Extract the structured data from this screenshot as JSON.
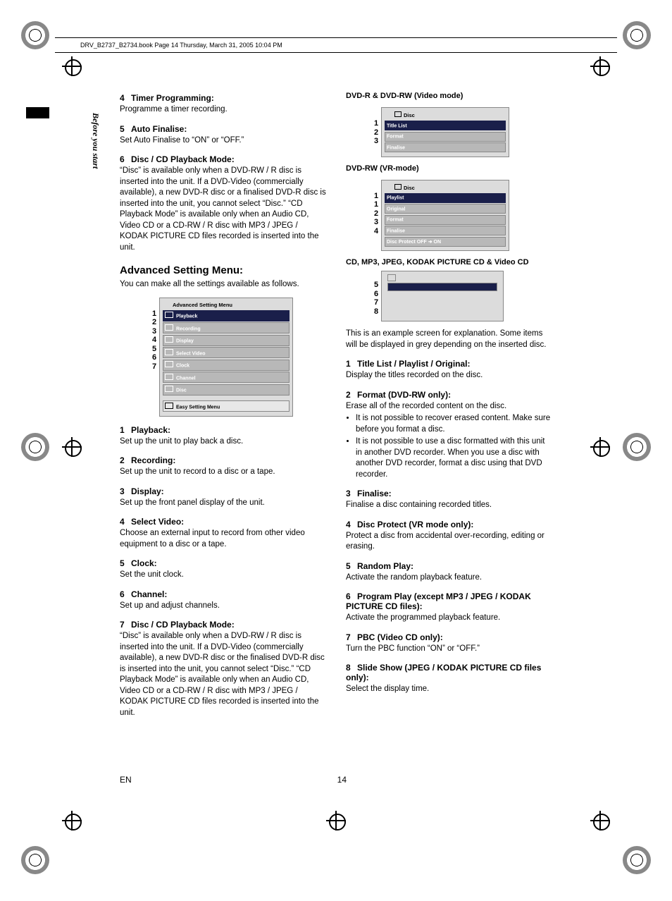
{
  "meta": {
    "header": "DRV_B2737_B2734.book  Page 14  Thursday, March 31, 2005  10:04 PM",
    "sidebar": "Before you start",
    "footer_left": "EN",
    "footer_page": "14"
  },
  "left": {
    "h4": {
      "n": "4",
      "t": "Timer Programming:",
      "b": "Programme a timer recording."
    },
    "h5": {
      "n": "5",
      "t": "Auto Finalise:",
      "b": "Set Auto Finalise to “ON” or “OFF.”"
    },
    "h6": {
      "n": "6",
      "t": "Disc / CD Playback Mode:",
      "b": "“Disc” is available only when a DVD-RW / R disc is inserted into the unit. If a DVD-Video (commercially available), a new DVD-R disc or a finalised DVD-R disc is inserted into the unit, you cannot select “Disc.” “CD Playback Mode” is available only when an Audio CD, Video CD or a CD-RW / R disc with MP3 / JPEG / KODAK PICTURE CD files recorded is inserted into the unit."
    },
    "section": "Advanced Setting Menu:",
    "section_intro": "You can make all the settings available as follows.",
    "menu": {
      "title": "Advanced Setting Menu",
      "rows": [
        "Playback",
        "Recording",
        "Display",
        "Select Video",
        "Clock",
        "Channel",
        "Disc"
      ],
      "last": "Easy Setting Menu",
      "nums": [
        "1",
        "2",
        "3",
        "4",
        "5",
        "6",
        "7"
      ]
    },
    "items": [
      {
        "n": "1",
        "t": "Playback:",
        "b": "Set up the unit to play back a disc."
      },
      {
        "n": "2",
        "t": "Recording:",
        "b": "Set up the unit to record to a disc or a tape."
      },
      {
        "n": "3",
        "t": "Display:",
        "b": "Set up the front panel display of the unit."
      },
      {
        "n": "4",
        "t": "Select Video:",
        "b": "Choose an external input to record from other video equipment to a disc or a tape."
      },
      {
        "n": "5",
        "t": "Clock:",
        "b": "Set the unit clock."
      },
      {
        "n": "6",
        "t": "Channel:",
        "b": "Set up and adjust channels."
      },
      {
        "n": "7",
        "t": "Disc / CD Playback Mode:",
        "b": "“Disc” is available only when a DVD-RW / R disc is inserted into the unit. If a DVD-Video (commercially available), a new DVD-R disc or the finalised DVD-R disc is inserted into the unit, you cannot select “Disc.” “CD Playback Mode” is available only when an Audio CD, Video CD or a CD-RW / R disc with MP3 / JPEG / KODAK PICTURE CD files recorded is inserted into the unit."
      }
    ]
  },
  "right": {
    "sub1": "DVD-R & DVD-RW (Video mode)",
    "menu1": {
      "title": "Disc",
      "rows": [
        "Title List",
        "Format",
        "Finalise"
      ],
      "nums": [
        "1",
        "2",
        "3"
      ]
    },
    "sub2": "DVD-RW (VR-mode)",
    "menu2": {
      "title": "Disc",
      "rows": [
        "Playlist",
        "Original",
        "Format",
        "Finalise",
        "Disc Protect OFF ➜ ON"
      ],
      "nums": [
        "1",
        "1",
        "2",
        "3",
        "4"
      ]
    },
    "sub3": "CD, MP3, JPEG, KODAK PICTURE CD & Video CD",
    "blank_nums": [
      "5",
      "6",
      "7",
      "8"
    ],
    "note": "This is an example screen for explanation. Some items will be displayed in grey depending on the inserted disc.",
    "items": [
      {
        "n": "1",
        "t": "Title List / Playlist / Original:",
        "b": "Display the titles recorded on the disc."
      },
      {
        "n": "2",
        "t": "Format (DVD-RW only):",
        "b": "Erase all of the recorded content on the disc.",
        "bul": [
          "It is not possible to recover erased content. Make sure before you format a disc.",
          "It is not possible to use a disc formatted with this unit in another DVD recorder. When you use a disc with another DVD recorder, format a disc using that DVD recorder."
        ]
      },
      {
        "n": "3",
        "t": "Finalise:",
        "b": "Finalise a disc containing recorded titles."
      },
      {
        "n": "4",
        "t": "Disc Protect (VR mode only):",
        "b": "Protect a disc from accidental over-recording, editing or erasing."
      },
      {
        "n": "5",
        "t": "Random Play:",
        "b": "Activate the random playback feature."
      },
      {
        "n": "6",
        "t": "Program Play (except MP3 / JPEG / KODAK PICTURE CD files):",
        "b": "Activate the programmed playback feature."
      },
      {
        "n": "7",
        "t": "PBC (Video CD only):",
        "b": "Turn the PBC function “ON” or “OFF.”"
      },
      {
        "n": "8",
        "t": "Slide Show (JPEG / KODAK PICTURE CD files only):",
        "b": "Select the display time."
      }
    ]
  }
}
